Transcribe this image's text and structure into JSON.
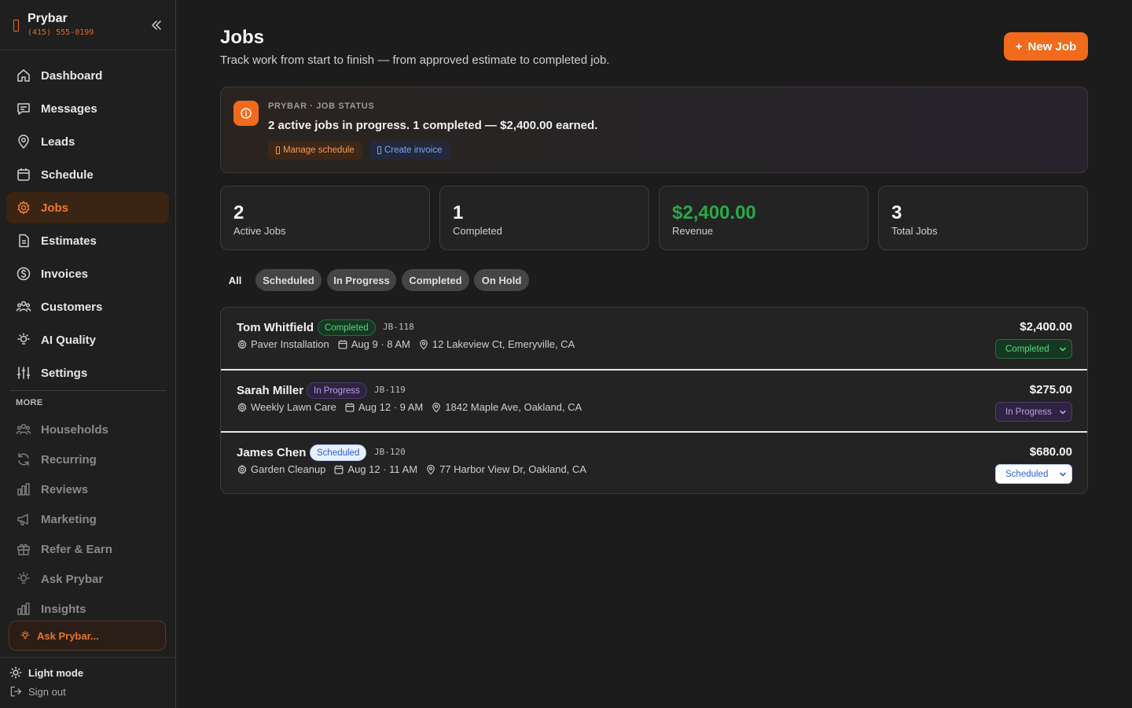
{
  "brand": {
    "name": "Prybar",
    "phone": "(415) 555-0199"
  },
  "sidebar": {
    "nav": [
      {
        "label": "Dashboard",
        "icon": "home-icon"
      },
      {
        "label": "Messages",
        "icon": "message-icon"
      },
      {
        "label": "Leads",
        "icon": "map-pin-icon"
      },
      {
        "label": "Schedule",
        "icon": "calendar-icon"
      },
      {
        "label": "Jobs",
        "icon": "gear-icon",
        "active": true
      },
      {
        "label": "Estimates",
        "icon": "document-icon"
      },
      {
        "label": "Invoices",
        "icon": "dollar-icon"
      },
      {
        "label": "Customers",
        "icon": "users-icon"
      },
      {
        "label": "AI Quality",
        "icon": "lightbulb-icon"
      },
      {
        "label": "Settings",
        "icon": "sliders-icon"
      }
    ],
    "more_heading": "MORE",
    "more": [
      {
        "label": "Households",
        "icon": "users-icon"
      },
      {
        "label": "Recurring",
        "icon": "refresh-icon"
      },
      {
        "label": "Reviews",
        "icon": "bar-chart-icon"
      },
      {
        "label": "Marketing",
        "icon": "megaphone-icon"
      },
      {
        "label": "Refer & Earn",
        "icon": "gift-icon"
      },
      {
        "label": "Ask Prybar",
        "icon": "lightbulb-icon"
      },
      {
        "label": "Insights",
        "icon": "bar-chart-icon"
      }
    ],
    "ask_box": "Ask Prybar...",
    "theme_toggle": "Light mode",
    "sign_out": "Sign out"
  },
  "header": {
    "title": "Jobs",
    "subtitle": "Track work from start to finish — from approved estimate to completed job.",
    "new_job_plus": "+",
    "new_job_label": "New Job"
  },
  "banner": {
    "eyebrow": "PRYBAR · JOB STATUS",
    "message": "2 active jobs in progress. 1 completed — $2,400.00 earned.",
    "chip_schedule": "Manage schedule",
    "chip_invoice": "Create invoice"
  },
  "stats": [
    {
      "value": "2",
      "label": "Active Jobs"
    },
    {
      "value": "1",
      "label": "Completed"
    },
    {
      "value": "$2,400.00",
      "label": "Revenue"
    },
    {
      "value": "3",
      "label": "Total Jobs"
    }
  ],
  "filters": [
    "All",
    "Scheduled",
    "In Progress",
    "Completed",
    "On Hold"
  ],
  "jobs": [
    {
      "customer": "Tom Whitfield",
      "status": "Completed",
      "id": "JB-118",
      "service": "Paver Installation",
      "date": "Aug 9 · 8 AM",
      "address": "12 Lakeview Ct, Emeryville, CA",
      "amount": "$2,400.00"
    },
    {
      "customer": "Sarah Miller",
      "status": "In Progress",
      "id": "JB-119",
      "service": "Weekly Lawn Care",
      "date": "Aug 12 · 9 AM",
      "address": "1842 Maple Ave, Oakland, CA",
      "amount": "$275.00"
    },
    {
      "customer": "James Chen",
      "status": "Scheduled",
      "id": "JB-120",
      "service": "Garden Cleanup",
      "date": "Aug 12 · 11 AM",
      "address": "77 Harbor View Dr, Oakland, CA",
      "amount": "$680.00"
    }
  ],
  "colors": {
    "accent": "#f26a1b",
    "revenue_green": "#2aa84a",
    "completed": "#5bd57a",
    "in_progress": "#c09cf0",
    "scheduled": "#2d5fd8"
  }
}
